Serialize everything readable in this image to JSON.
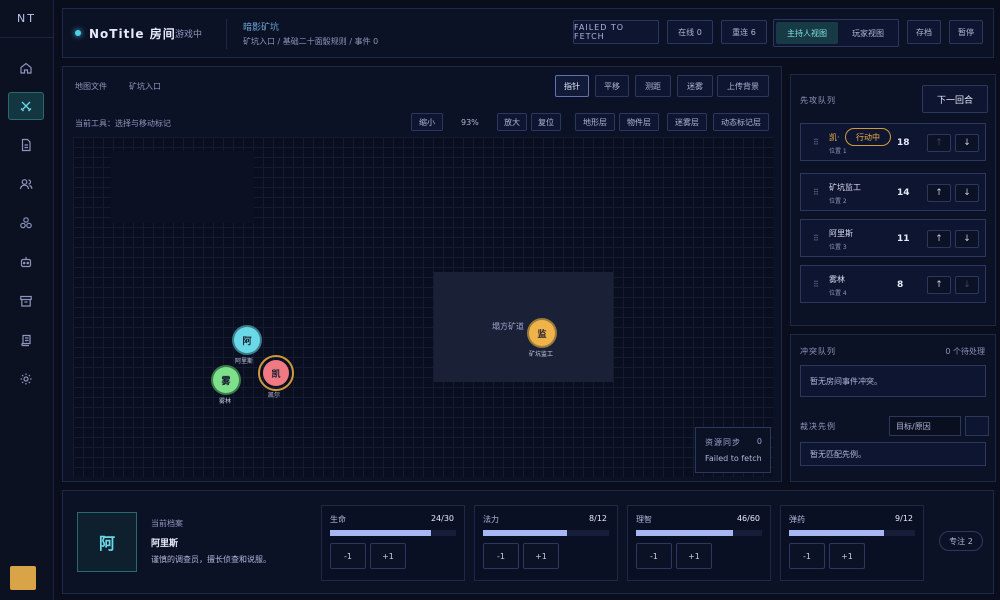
{
  "sidebar": {
    "brand": "NT",
    "items": [
      {
        "icon": "home-icon"
      },
      {
        "icon": "crossed-swords-icon",
        "active": true
      },
      {
        "icon": "document-icon"
      },
      {
        "icon": "users-icon"
      },
      {
        "icon": "cubes-icon"
      },
      {
        "icon": "robot-icon"
      },
      {
        "icon": "archive-icon"
      },
      {
        "icon": "scroll-icon"
      },
      {
        "icon": "gear-icon"
      }
    ]
  },
  "header": {
    "room_title": "NoTitle 房间",
    "room_status": "游戏中",
    "scene_name": "暗影矿坑",
    "scene_path": "矿坑入口 / 基础二十面骰规则 / 事件 0",
    "fetch_status": "FAILED TO FETCH",
    "online": "在线 0",
    "reconnect": "重连 6",
    "gm_view": "主持人视图",
    "player_view": "玩家视图",
    "save": "存档",
    "pause": "暂停"
  },
  "map": {
    "label": "地图文件",
    "file": "矿坑入口",
    "tools": [
      "指针",
      "平移",
      "测距",
      "迷雾",
      "上传背景"
    ],
    "tool_hint": "当前工具：选择与移动标记",
    "zoom_out": "缩小",
    "zoom": "93%",
    "zoom_in": "放大",
    "reset": "复位",
    "layers": [
      "地形层",
      "物件层",
      "迷雾层",
      "动态标记层"
    ],
    "room_label": "塌方矿道",
    "tokens": [
      {
        "char": "阿",
        "name": "阿里斯",
        "color": "#6ad8e6"
      },
      {
        "char": "凯",
        "name": "凯尔",
        "color": "#f07a82"
      },
      {
        "char": "雾",
        "name": "雾林",
        "color": "#7ee08a"
      },
      {
        "char": "监",
        "name": "矿坑监工",
        "color": "#f0b34a"
      }
    ],
    "sync_title": "资源同步",
    "sync_count": "0",
    "sync_msg": "Failed to fetch"
  },
  "initiative": {
    "title": "先攻队列",
    "next_round": "下一回合",
    "acting_badge": "行动中",
    "entries": [
      {
        "name": "凯·",
        "position": "位置 1",
        "value": "18",
        "acting": true
      },
      {
        "name": "矿坑监工",
        "position": "位置 2",
        "value": "14"
      },
      {
        "name": "阿里斯",
        "position": "位置 3",
        "value": "11"
      },
      {
        "name": "雾林",
        "position": "位置 4",
        "value": "8"
      }
    ],
    "up": "↑",
    "down": "↓"
  },
  "conflict": {
    "title": "冲突队列",
    "pending": "0 个待处理",
    "empty_msg": "暂无房间事件冲突。",
    "rulings_title": "裁决先例",
    "rulings_placeholder": "目标/原因",
    "rulings_empty": "暂无匹配先例。"
  },
  "profile": {
    "label": "当前档案",
    "portrait_char": "阿",
    "name": "阿里斯",
    "description": "谨慎的调查员，擅长侦查和说服。",
    "stats": [
      {
        "name": "生命",
        "value": "24/30",
        "fill": 0.8
      },
      {
        "name": "法力",
        "value": "8/12",
        "fill": 0.667
      },
      {
        "name": "理智",
        "value": "46/60",
        "fill": 0.767
      },
      {
        "name": "弹药",
        "value": "9/12",
        "fill": 0.75
      }
    ],
    "minus": "-1",
    "plus": "+1",
    "focus": "专注 2"
  }
}
